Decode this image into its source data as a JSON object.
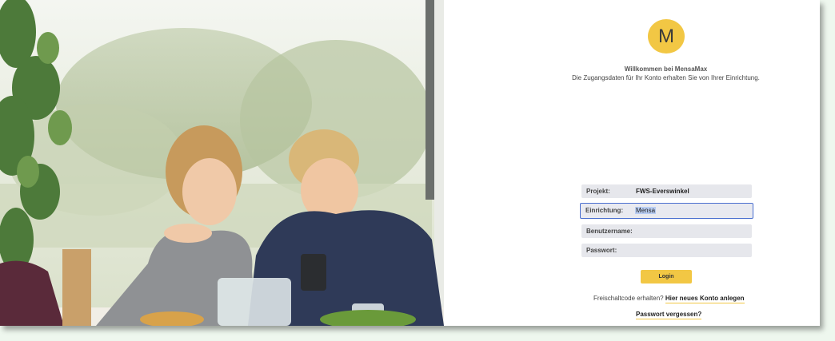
{
  "logo": {
    "letter": "M",
    "color": "#f2c744"
  },
  "welcome": {
    "title": "Willkommen bei MensaMax",
    "subtitle": "Die Zugangsdaten für Ihr Konto erhalten Sie von Ihrer Einrichtung."
  },
  "form": {
    "project": {
      "label": "Projekt:",
      "value": "FWS-Everswinkel"
    },
    "facility": {
      "label": "Einrichtung:",
      "value": "Mensa"
    },
    "username": {
      "label": "Benutzername:",
      "value": ""
    },
    "password": {
      "label": "Passwort:",
      "value": ""
    },
    "login_label": "Login"
  },
  "links": {
    "code_text": "Freischaltcode erhalten?",
    "new_account": "Hier neues Konto anlegen",
    "forgot_password": "Passwort vergessen?"
  },
  "colors": {
    "accent": "#f2c744",
    "focus_border": "#4a6fcf",
    "field_bg": "#e6e7ec"
  }
}
